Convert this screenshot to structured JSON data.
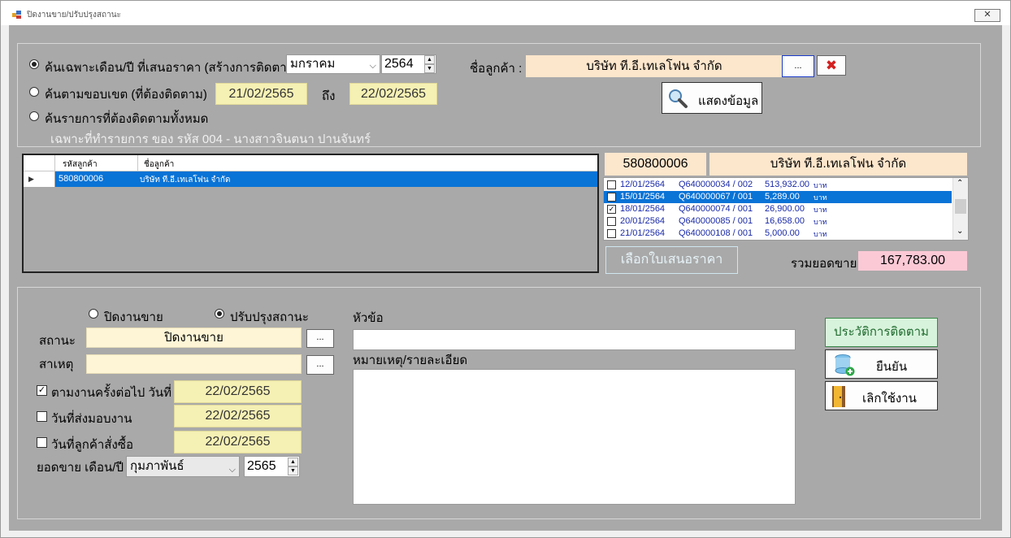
{
  "window": {
    "title": "ปิดงานขาย/ปรับปรุงสถานะ",
    "close_symbol": "✕"
  },
  "search": {
    "radio_month": "ค้นเฉพาะเดือน/ปี ที่เสนอราคา (สร้างการติดตาม)",
    "month_value": "มกราคม",
    "year_value": "2564",
    "radio_range": "ค้นตามขอบเขต (ที่ต้องติดตาม)",
    "date_from": "21/02/2565",
    "to_label": "ถึง",
    "date_to": "22/02/2565",
    "radio_all": "ค้นรายการที่ต้องติดตามทั้งหมด",
    "owner_note": "เฉพาะที่ทำรายการ ของ   รหัส 004 - นางสาวจินตนา ปานจันทร์",
    "customer_label": "ชื่อลูกค้า :",
    "customer_value": "บริษัท ที.อี.เทเลโฟน จำกัด",
    "browse_label": "...",
    "clear_symbol": "✖",
    "show_button": "แสดงข้อมูล"
  },
  "grid": {
    "columns": [
      "รหัสลูกค้า",
      "ชื่อลูกค้า"
    ],
    "rows": [
      {
        "indicator": "▶",
        "code": "580800006",
        "name": "บริษัท ที.อี.เทเลโฟน จำกัด"
      }
    ]
  },
  "detail": {
    "customer_code": "580800006",
    "customer_name": "บริษัท ที.อี.เทเลโฟน จำกัด",
    "quotes": [
      {
        "checked": false,
        "date": "12/01/2564",
        "doc": "Q640000034 / 002",
        "amount": "513,932.00",
        "unit": "บาท",
        "selected": false
      },
      {
        "checked": false,
        "date": "15/01/2564",
        "doc": "Q640000067 / 001",
        "amount": "5,289.00",
        "unit": "บาท",
        "selected": true
      },
      {
        "checked": true,
        "date": "18/01/2564",
        "doc": "Q640000074 / 001",
        "amount": "26,900.00",
        "unit": "บาท",
        "selected": false
      },
      {
        "checked": false,
        "date": "20/01/2564",
        "doc": "Q640000085 / 001",
        "amount": "16,658.00",
        "unit": "บาท",
        "selected": false
      },
      {
        "checked": false,
        "date": "21/01/2564",
        "doc": "Q640000108 / 001",
        "amount": "5,000.00",
        "unit": "บาท",
        "selected": false
      }
    ],
    "select_quote_button": "เลือกใบเสนอราคา",
    "total_label": "รวมยอดขาย",
    "total_value": "167,783.00"
  },
  "form": {
    "radio_close": "ปิดงานขาย",
    "radio_update": "ปรับปรุงสถานะ",
    "status_label": "สถานะ",
    "status_value": "ปิดงานขาย",
    "reason_label": "สาเหตุ",
    "reason_value": "",
    "browse_label": "...",
    "next_follow_label": "ตามงานครั้งต่อไป วันที่",
    "next_follow_date": "22/02/2565",
    "delivery_label": "วันที่ส่งมอบงาน",
    "delivery_date": "22/02/2565",
    "order_label": "วันที่ลูกค้าสั่งซื้อ",
    "order_date": "22/02/2565",
    "sales_period_label": "ยอดขาย เดือน/ปี",
    "sales_month": "กุมภาพันธ์",
    "sales_year": "2565",
    "topic_label": "หัวข้อ",
    "topic_value": "",
    "note_label": "หมายเหตุ/รายละเอียด",
    "note_value": ""
  },
  "actions": {
    "history_button": "ประวัติการติดตาม",
    "confirm_button": "ยืนยัน",
    "exit_button": "เลิกใช้งาน"
  }
}
